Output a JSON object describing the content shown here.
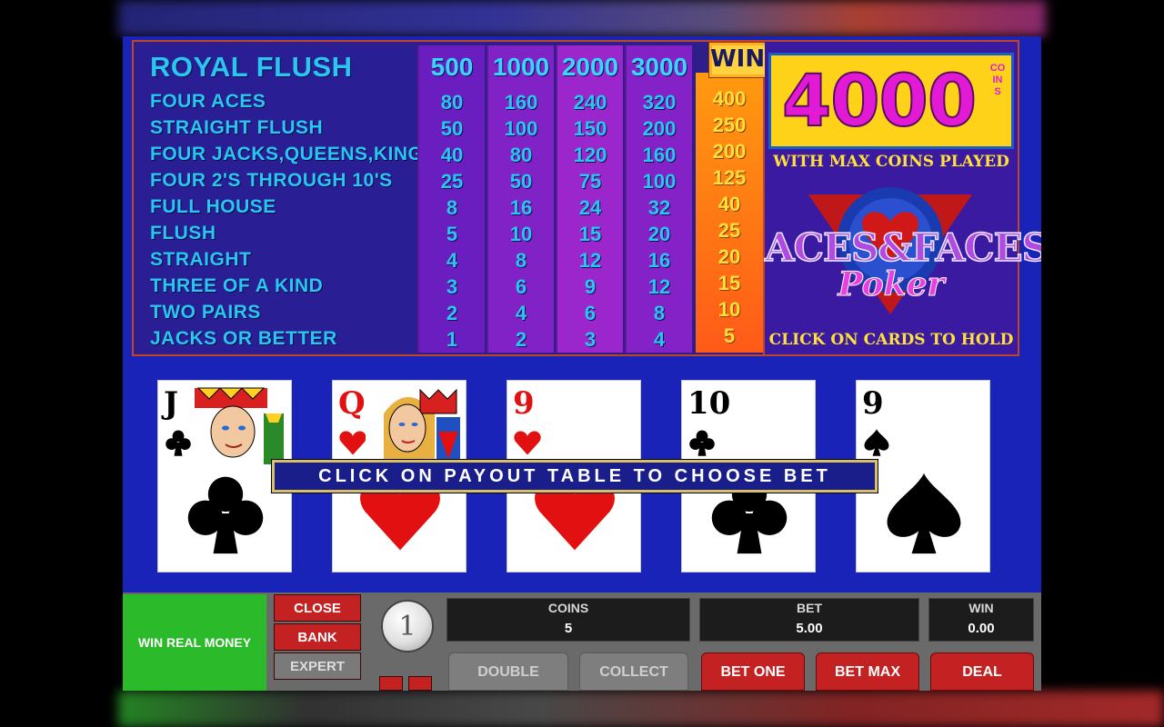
{
  "paytable": {
    "hands": [
      "ROYAL FLUSH",
      "FOUR ACES",
      "STRAIGHT FLUSH",
      "FOUR JACKS,QUEENS,KINGS",
      "FOUR 2'S THROUGH 10'S",
      "FULL HOUSE",
      "FLUSH",
      "STRAIGHT",
      "THREE OF A KIND",
      "TWO PAIRS",
      "JACKS OR BETTER"
    ],
    "columns": [
      [
        "500",
        "80",
        "50",
        "40",
        "25",
        "8",
        "5",
        "4",
        "3",
        "2",
        "1"
      ],
      [
        "1000",
        "160",
        "100",
        "80",
        "50",
        "16",
        "10",
        "8",
        "6",
        "4",
        "2"
      ],
      [
        "2000",
        "240",
        "150",
        "120",
        "75",
        "24",
        "15",
        "12",
        "9",
        "6",
        "3"
      ],
      [
        "3000",
        "320",
        "200",
        "160",
        "100",
        "32",
        "20",
        "16",
        "12",
        "8",
        "4"
      ]
    ],
    "wins_label": "WINS",
    "wins": [
      "400",
      "250",
      "200",
      "125",
      "40",
      "25",
      "20",
      "15",
      "10",
      "5"
    ]
  },
  "info": {
    "top_award": "4000",
    "top_award_unit": "COINS",
    "max_coins_text": "WITH MAX COINS PLAYED",
    "logo_main": "ACES&FACES",
    "logo_sub": "Poker",
    "hold_hint": "CLICK ON CARDS TO HOLD"
  },
  "cards": [
    {
      "rank": "J",
      "suit": "clubs"
    },
    {
      "rank": "Q",
      "suit": "hearts"
    },
    {
      "rank": "9",
      "suit": "hearts"
    },
    {
      "rank": "10",
      "suit": "clubs"
    },
    {
      "rank": "9",
      "suit": "spades"
    }
  ],
  "banner": "CLICK ON PAYOUT TABLE TO CHOOSE BET",
  "controls": {
    "win_real_money": "WIN REAL MONEY",
    "close": "CLOSE",
    "bank": "BANK",
    "expert": "EXPERT",
    "coin_value": "1",
    "coins_label": "COINS",
    "coins_value": "5",
    "bet_label": "BET",
    "bet_value": "5.00",
    "win_label": "WIN",
    "win_value": "0.00",
    "double": "DOUBLE",
    "collect": "COLLECT",
    "bet_one": "BET ONE",
    "bet_max": "BET MAX",
    "deal": "DEAL"
  },
  "colors": {
    "table_bg": "#2d1e8a",
    "text_cyan": "#28c6f0",
    "wins_orange": "#ff7a14",
    "award_magenta": "#e21ad6",
    "button_red": "#c42222",
    "button_green": "#2aba2a"
  }
}
